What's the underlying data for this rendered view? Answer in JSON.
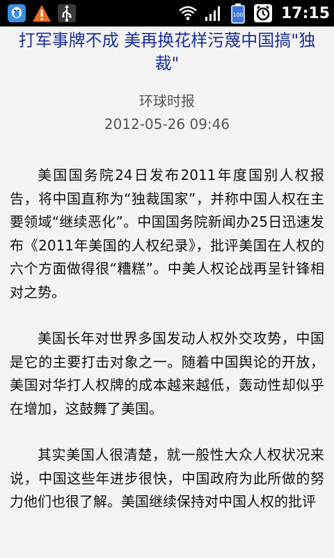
{
  "status_bar": {
    "time": "17:15",
    "battery_level": "100",
    "icons": [
      "qq-penguin-icon",
      "warning-icon",
      "usb-icon",
      "wifi-icon",
      "signal-icon",
      "battery-icon",
      "alarm-icon"
    ]
  },
  "article": {
    "title": "打军事牌不成 美再换花样污蔑中国搞\"独裁\"",
    "source": "环球时报",
    "date": "2012-05-26 09:46",
    "paragraphs": [
      "美国国务院24日发布2011年度国别人权报告，将中国直称为“独裁国家”，并称中国人权在主要领域“继续恶化”。中国国务院新闻办25日迅速发布《2011年美国的人权纪录》，批评美国在人权的六个方面做得很“糟糕”。中美人权论战再呈针锋相对之势。",
      "美国长年对世界多国发动人权外交攻势，中国是它的主要打击对象之一。随着中国舆论的开放，美国对华打人权牌的成本越来越低，轰动性却似乎在增加，这鼓舞了美国。",
      "其实美国人很清楚，就一般性大众人权状况来说，中国这些年进步很快，中国政府为此所做的努力他们也很了解。美国继续保持对中国人权的批评"
    ]
  },
  "colors": {
    "title": "#1a2f9c",
    "status_bar_bg": "#000000",
    "page_bg": "#f4f4f4",
    "warning": "#f26b1d",
    "qq": "#3a8fe0"
  }
}
